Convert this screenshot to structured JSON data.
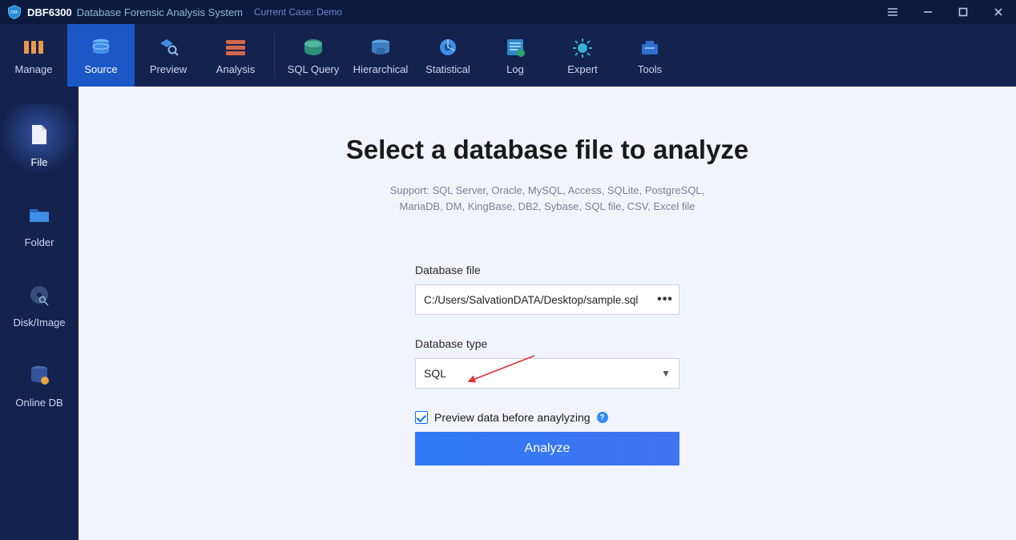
{
  "titlebar": {
    "app_name": "DBF6300",
    "app_subtitle": "Database Forensic Analysis System",
    "case_prefix": "Current Case:",
    "case_name": "Demo"
  },
  "topnav": {
    "items": [
      {
        "key": "manage",
        "label": "Manage"
      },
      {
        "key": "source",
        "label": "Source"
      },
      {
        "key": "preview",
        "label": "Preview"
      },
      {
        "key": "analysis",
        "label": "Analysis"
      },
      {
        "key": "sql-query",
        "label": "SQL Query"
      },
      {
        "key": "hierarchical",
        "label": "Hierarchical"
      },
      {
        "key": "statistical",
        "label": "Statistical"
      },
      {
        "key": "log",
        "label": "Log"
      },
      {
        "key": "expert",
        "label": "Expert"
      },
      {
        "key": "tools",
        "label": "Tools"
      }
    ],
    "active": "source"
  },
  "sidebar": {
    "items": [
      {
        "key": "file",
        "label": "File"
      },
      {
        "key": "folder",
        "label": "Folder"
      },
      {
        "key": "disk-image",
        "label": "Disk/Image"
      },
      {
        "key": "online-db",
        "label": "Online DB"
      }
    ],
    "active": "file"
  },
  "main": {
    "heading": "Select a database file to analyze",
    "support_line1": "Support: SQL Server, Oracle, MySQL, Access, SQLite, PostgreSQL,",
    "support_line2": "MariaDB, DM, KingBase, DB2, Sybase, SQL file, CSV, Excel file",
    "file_label": "Database file",
    "file_value": "C:/Users/SalvationDATA/Desktop/sample.sql",
    "browse_glyph": "•••",
    "type_label": "Database type",
    "type_value": "SQL",
    "preview_checkbox_label": "Preview data before anaylyzing",
    "preview_checked": true,
    "analyze_label": "Analyze"
  }
}
